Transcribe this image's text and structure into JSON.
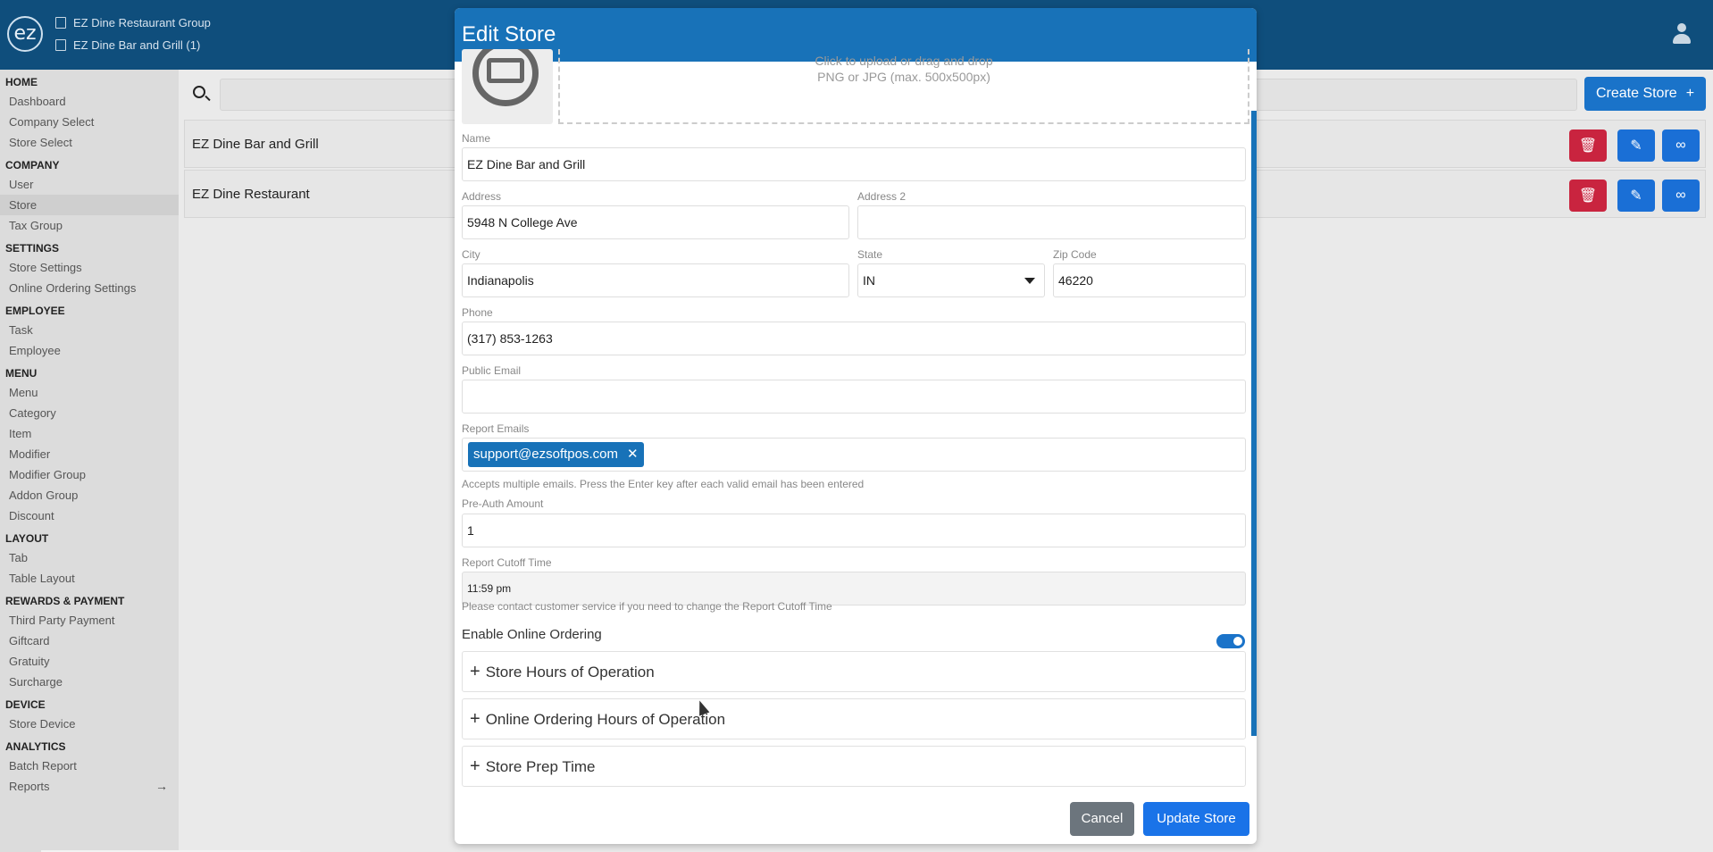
{
  "header": {
    "logo_text": "ez",
    "org_name": "EZ Dine Restaurant Group",
    "store_name": "EZ Dine Bar and Grill (1)"
  },
  "sidebar": {
    "sections": [
      {
        "title": "HOME",
        "items": [
          "Dashboard",
          "Company Select",
          "Store Select"
        ]
      },
      {
        "title": "COMPANY",
        "items": [
          "User",
          "Store",
          "Tax Group"
        ]
      },
      {
        "title": "SETTINGS",
        "items": [
          "Store Settings",
          "Online Ordering Settings"
        ]
      },
      {
        "title": "EMPLOYEE",
        "items": [
          "Task",
          "Employee"
        ]
      },
      {
        "title": "MENU",
        "items": [
          "Menu",
          "Category",
          "Item",
          "Modifier",
          "Modifier Group",
          "Addon Group",
          "Discount"
        ]
      },
      {
        "title": "LAYOUT",
        "items": [
          "Tab",
          "Table Layout"
        ]
      },
      {
        "title": "REWARDS & PAYMENT",
        "items": [
          "Third Party Payment",
          "Giftcard",
          "Gratuity",
          "Surcharge"
        ]
      },
      {
        "title": "DEVICE",
        "items": [
          "Store Device"
        ]
      },
      {
        "title": "ANALYTICS",
        "items": [
          "Batch Report",
          "Reports"
        ]
      }
    ],
    "active_item": "Store"
  },
  "main": {
    "create_label": "Create Store",
    "rows": [
      "EZ Dine Bar and Grill",
      "EZ Dine Restaurant"
    ]
  },
  "modal": {
    "title": "Edit Store",
    "upload_line1": "Click to upload or drag and drop",
    "upload_line2": "PNG or JPG (max. 500x500px)",
    "name_label": "Name",
    "name_value": "EZ Dine Bar and Grill",
    "address_label": "Address",
    "address_value": "5948 N College Ave",
    "address2_label": "Address 2",
    "address2_value": "",
    "city_label": "City",
    "city_value": "Indianapolis",
    "state_label": "State",
    "state_value": "IN",
    "zip_label": "Zip Code",
    "zip_value": "46220",
    "phone_label": "Phone",
    "phone_value": "(317) 853-1263",
    "public_email_label": "Public Email",
    "public_email_value": "",
    "report_emails_label": "Report Emails",
    "report_email_chip": "support@ezsoftpos.com",
    "report_emails_help": "Accepts multiple emails. Press the Enter key after each valid email has been entered",
    "preauth_label": "Pre-Auth Amount",
    "preauth_value": "1",
    "cutoff_label": "Report Cutoff Time",
    "cutoff_value": "11:59 pm",
    "cutoff_help": "Please contact customer service if you need to change the Report Cutoff Time",
    "online_ordering_label": "Enable Online Ordering",
    "online_ordering_enabled": true,
    "accordions": [
      "Store Hours of Operation",
      "Online Ordering Hours of Operation",
      "Store Prep Time"
    ],
    "cancel_label": "Cancel",
    "update_label": "Update Store"
  },
  "colors": {
    "topbar": "#0f4e7c",
    "primary": "#1872b8",
    "danger": "#c9243f"
  }
}
